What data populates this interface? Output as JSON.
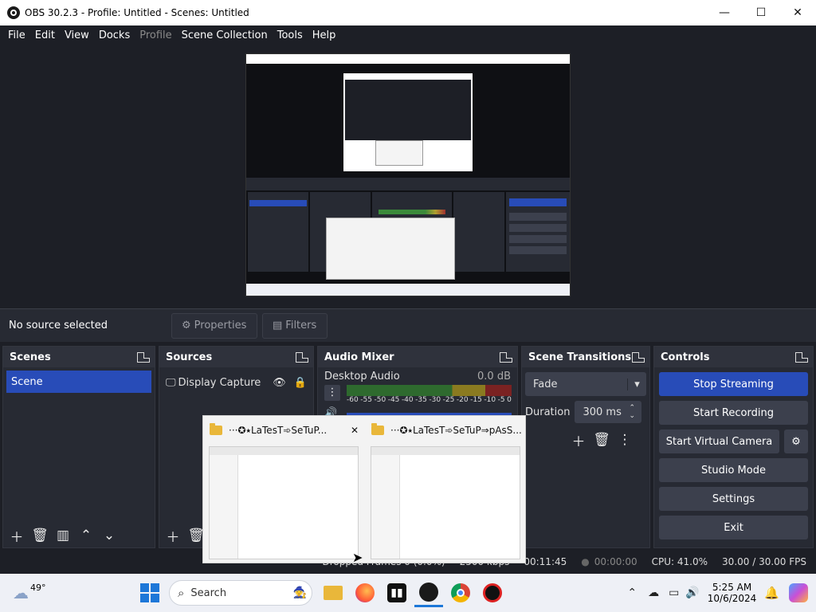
{
  "window": {
    "title": "OBS 30.2.3 - Profile: Untitled - Scenes: Untitled",
    "minimize": "—",
    "maximize": "☐",
    "close": "✕"
  },
  "menu": [
    "File",
    "Edit",
    "View",
    "Docks",
    "Profile",
    "Scene Collection",
    "Tools",
    "Help"
  ],
  "context_bar": {
    "no_source": "No source selected",
    "properties": "Properties",
    "filters": "Filters"
  },
  "scenes": {
    "title": "Scenes",
    "items": [
      "Scene"
    ]
  },
  "sources": {
    "title": "Sources",
    "items": [
      "Display Capture"
    ]
  },
  "audio_mixer": {
    "title": "Audio Mixer",
    "channel": "Desktop Audio",
    "level": "0.0 dB",
    "scale": [
      "-60",
      "-55",
      "-50",
      "-45",
      "-40",
      "-35",
      "-30",
      "-25",
      "-20",
      "-15",
      "-10",
      "-5",
      "0"
    ]
  },
  "transitions": {
    "title": "Scene Transitions",
    "selected": "Fade",
    "duration_label": "Duration",
    "duration_value": "300 ms"
  },
  "controls": {
    "title": "Controls",
    "stop_streaming": "Stop Streaming",
    "start_recording": "Start Recording",
    "start_virtual_camera": "Start Virtual Camera",
    "studio_mode": "Studio Mode",
    "settings": "Settings",
    "exit": "Exit"
  },
  "status": {
    "dropped": "Dropped Frames 0 (0.0%)",
    "kbps": "2500 kbps",
    "stream_time": "00:11:45",
    "rec_time": "00:00:00",
    "cpu": "CPU: 41.0%",
    "fps": "30.00 / 30.00 FPS"
  },
  "thumbnails": [
    {
      "title": "···✪⭑LaTesT➾SeTuP..."
    },
    {
      "title": "···✪⭑LaTesT➾SeTuP⇒pAsS..."
    }
  ],
  "taskbar": {
    "weather": "49°",
    "search_placeholder": "Search",
    "time": "5:25 AM",
    "date": "10/6/2024"
  },
  "colors": {
    "accent_blue": "#284cb8",
    "panel": "#272a33",
    "background": "#1d1f26"
  }
}
